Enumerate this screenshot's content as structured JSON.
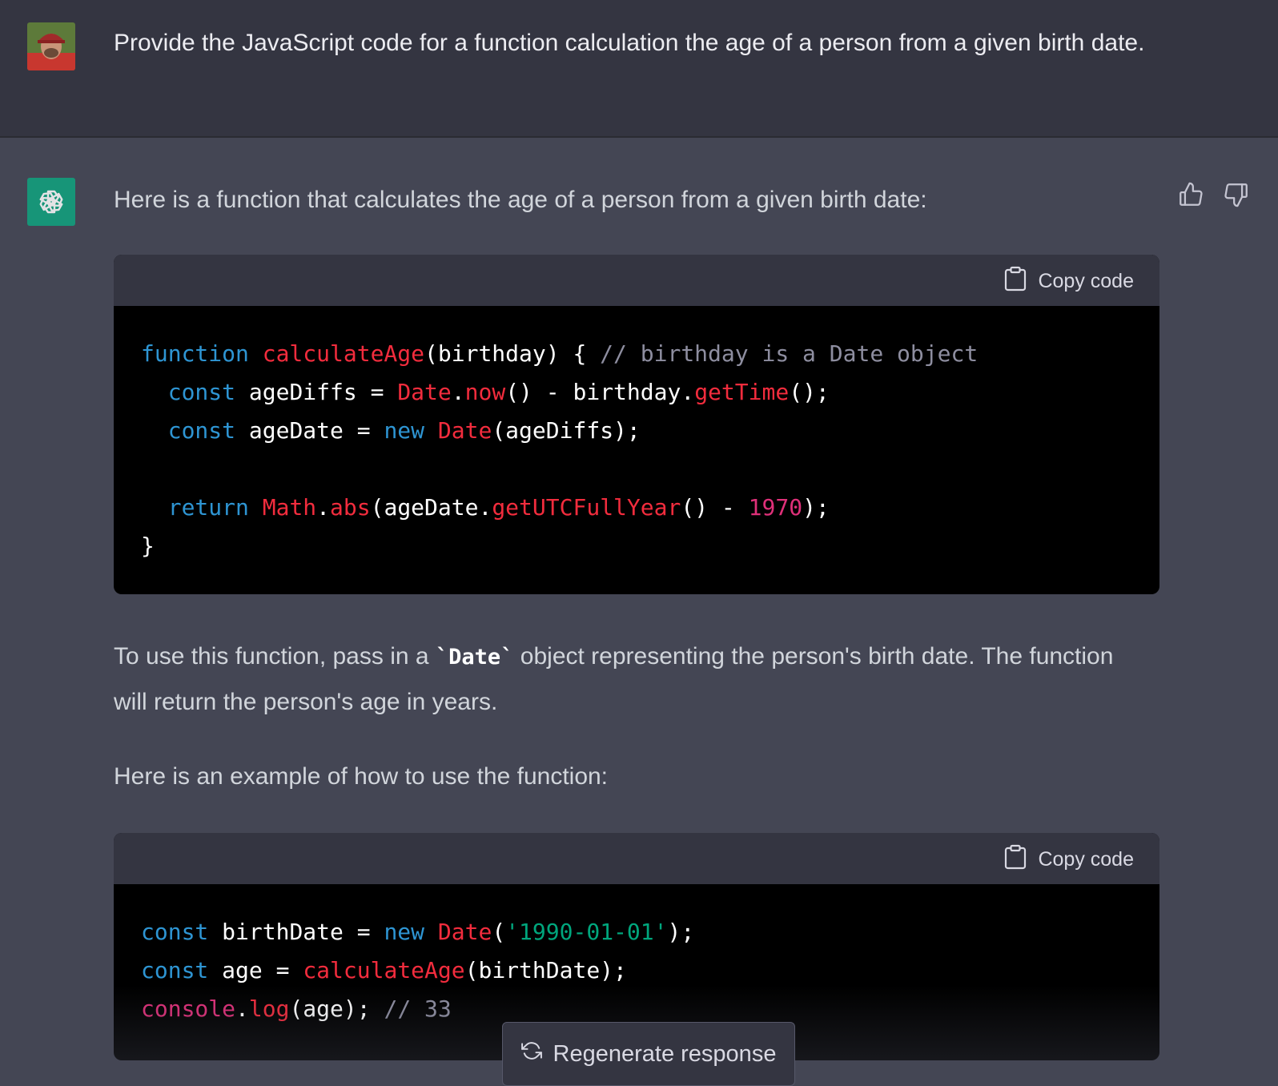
{
  "user": {
    "prompt": "Provide the JavaScript code for a function calculation the age of a person from a given birth date."
  },
  "assistant": {
    "intro": "Here is a function that calculates the age of a person from a given birth date:",
    "usage_before": "To use this function, pass in a ",
    "usage_code": "`Date`",
    "usage_after": " object representing the person's birth date. The function will return the person's age in years.",
    "example_intro": "Here is an example of how to use the function:"
  },
  "code_block_1": {
    "copy_label": "Copy code",
    "tokens": {
      "l1_function": "function",
      "l1_name": "calculateAge",
      "l1_params": "(birthday) { ",
      "l1_comment": "// birthday is a Date object",
      "l2_const": "const",
      "l2_var": " ageDiffs = ",
      "l2_date": "Date",
      "l2_dot": ".",
      "l2_now": "now",
      "l2_mid": "() - birthday.",
      "l2_gettime": "getTime",
      "l2_end": "();",
      "l3_const": "const",
      "l3_var": " ageDate = ",
      "l3_new": "new",
      "l3_sp": " ",
      "l3_date": "Date",
      "l3_end": "(ageDiffs);",
      "l5_return": "return",
      "l5_sp": " ",
      "l5_math": "Math",
      "l5_dot": ".",
      "l5_abs": "abs",
      "l5_mid": "(ageDate.",
      "l5_getutc": "getUTCFullYear",
      "l5_mid2": "() - ",
      "l5_num": "1970",
      "l5_end": ");",
      "l6_brace": "}"
    }
  },
  "code_block_2": {
    "copy_label": "Copy code",
    "tokens": {
      "l1_const": "const",
      "l1_var": " birthDate = ",
      "l1_new": "new",
      "l1_sp": " ",
      "l1_date": "Date",
      "l1_paren": "(",
      "l1_str": "'1990-01-01'",
      "l1_end": ");",
      "l2_const": "const",
      "l2_var": " age = ",
      "l2_fn": "calculateAge",
      "l2_end": "(birthDate);",
      "l3_console": "console",
      "l3_dot": ".",
      "l3_log": "log",
      "l3_end": "(age); ",
      "l3_comment": "// 33"
    }
  },
  "controls": {
    "regenerate_label": "Regenerate response"
  },
  "icons": {
    "thumbs_up": "thumbs-up-icon",
    "thumbs_down": "thumbs-down-icon",
    "clipboard": "clipboard-icon",
    "refresh": "refresh-icon"
  },
  "colors": {
    "user_bg": "#343541",
    "assistant_bg": "#444654",
    "code_bg": "#000000",
    "keyword": "#2e95d3",
    "function": "#f22c3d",
    "comment": "#8e8ea0",
    "number": "#df3079",
    "string": "#00a67d",
    "bot_avatar": "#10a37f"
  }
}
